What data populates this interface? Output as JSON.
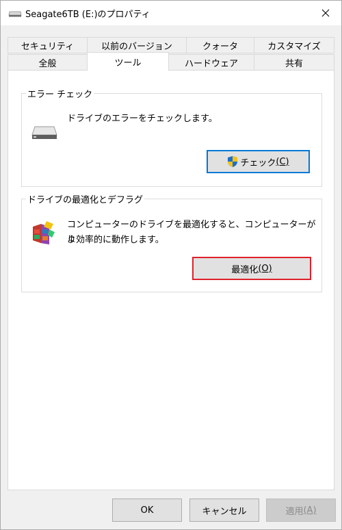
{
  "window": {
    "title": "Seagate6TB (E:)のプロパティ",
    "close_glyph": "✕"
  },
  "tabs": {
    "row1": [
      "セキュリティ",
      "以前のバージョン",
      "クォータ",
      "カスタマイズ"
    ],
    "row2": [
      "全般",
      "ツール",
      "ハードウェア",
      "共有"
    ],
    "active": "ツール"
  },
  "error_check": {
    "group_label": "エラー チェック",
    "description": "ドライブのエラーをチェックします。",
    "button_label": "チェック",
    "button_accel": "(C)",
    "icon": "drive-icon",
    "button_icon": "uac-shield-icon"
  },
  "optimize": {
    "group_label": "ドライブの最適化とデフラグ",
    "description_line1": "コンピューターのドライブを最適化すると、コンピューターがよ",
    "description_line2": "り効率的に動作します。",
    "button_label": "最適化",
    "button_accel": "(O)",
    "icon": "defrag-icon"
  },
  "footer": {
    "ok_label": "OK",
    "cancel_label": "キャンセル",
    "apply_label": "適用",
    "apply_accel": "(A)"
  },
  "colors": {
    "accent_blue": "#0078d7",
    "highlight_red": "#e0202a"
  }
}
